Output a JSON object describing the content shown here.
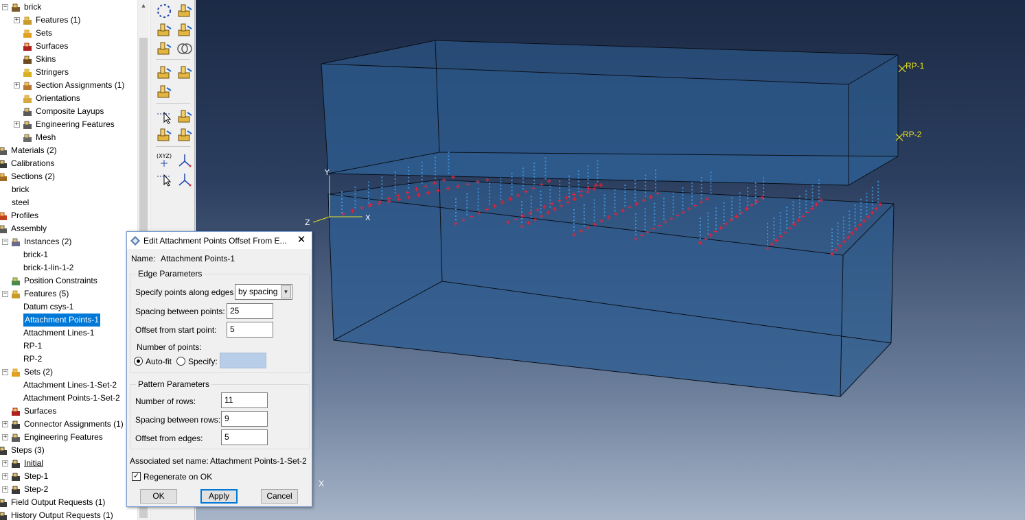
{
  "tree": {
    "items": [
      {
        "label": "brick",
        "indent": 0,
        "exp": "minus",
        "icon": "part"
      },
      {
        "label": "Features (1)",
        "indent": 1,
        "exp": "plus",
        "icon": "features"
      },
      {
        "label": "Sets",
        "indent": 1,
        "exp": "",
        "icon": "sets"
      },
      {
        "label": "Surfaces",
        "indent": 1,
        "exp": "",
        "icon": "surfaces"
      },
      {
        "label": "Skins",
        "indent": 1,
        "exp": "",
        "icon": "skins"
      },
      {
        "label": "Stringers",
        "indent": 1,
        "exp": "",
        "icon": "stringers"
      },
      {
        "label": "Section Assignments (1)",
        "indent": 1,
        "exp": "plus",
        "icon": "section-assign"
      },
      {
        "label": "Orientations",
        "indent": 1,
        "exp": "",
        "icon": "orientations"
      },
      {
        "label": "Composite Layups",
        "indent": 1,
        "exp": "",
        "icon": "layups"
      },
      {
        "label": "Engineering Features",
        "indent": 1,
        "exp": "plus",
        "icon": "eng-features"
      },
      {
        "label": "Mesh",
        "indent": 1,
        "exp": "",
        "icon": "mesh"
      },
      {
        "label": "Materials (2)",
        "indent": -1,
        "exp": "",
        "icon": "materials"
      },
      {
        "label": "Calibrations",
        "indent": -1,
        "exp": "",
        "icon": "calibrations"
      },
      {
        "label": "Sections (2)",
        "indent": -1,
        "exp": "",
        "icon": "sections"
      },
      {
        "label": "brick",
        "indent": 0,
        "exp": "",
        "icon": ""
      },
      {
        "label": "steel",
        "indent": 0,
        "exp": "",
        "icon": ""
      },
      {
        "label": "Profiles",
        "indent": -1,
        "exp": "",
        "icon": "profiles"
      },
      {
        "label": "Assembly",
        "indent": -1,
        "exp": "",
        "icon": "assembly"
      },
      {
        "label": "Instances (2)",
        "indent": 0,
        "exp": "minus",
        "icon": "instances"
      },
      {
        "label": "brick-1",
        "indent": 1,
        "exp": "",
        "icon": ""
      },
      {
        "label": "brick-1-lin-1-2",
        "indent": 1,
        "exp": "",
        "icon": ""
      },
      {
        "label": "Position Constraints",
        "indent": 0,
        "exp": "",
        "icon": "position"
      },
      {
        "label": "Features (5)",
        "indent": 0,
        "exp": "minus",
        "icon": "features"
      },
      {
        "label": "Datum csys-1",
        "indent": 1,
        "exp": "",
        "icon": ""
      },
      {
        "label": "Attachment Points-1",
        "indent": 1,
        "exp": "",
        "icon": "",
        "selected": true
      },
      {
        "label": "Attachment Lines-1",
        "indent": 1,
        "exp": "",
        "icon": ""
      },
      {
        "label": "RP-1",
        "indent": 1,
        "exp": "",
        "icon": ""
      },
      {
        "label": "RP-2",
        "indent": 1,
        "exp": "",
        "icon": ""
      },
      {
        "label": "Sets (2)",
        "indent": 0,
        "exp": "minus",
        "icon": "sets"
      },
      {
        "label": "Attachment Lines-1-Set-2",
        "indent": 1,
        "exp": "",
        "icon": ""
      },
      {
        "label": "Attachment Points-1-Set-2",
        "indent": 1,
        "exp": "",
        "icon": ""
      },
      {
        "label": "Surfaces",
        "indent": 0,
        "exp": "",
        "icon": "surfaces"
      },
      {
        "label": "Connector Assignments (1)",
        "indent": 0,
        "exp": "plus",
        "icon": "connector"
      },
      {
        "label": "Engineering Features",
        "indent": 0,
        "exp": "plus",
        "icon": "eng-features"
      },
      {
        "label": "Steps (3)",
        "indent": -1,
        "exp": "",
        "icon": "steps"
      },
      {
        "label": "Initial",
        "indent": 0,
        "exp": "plus",
        "icon": "step-initial",
        "underline": true
      },
      {
        "label": "Step-1",
        "indent": 0,
        "exp": "plus",
        "icon": "step"
      },
      {
        "label": "Step-2",
        "indent": 0,
        "exp": "plus",
        "icon": "step"
      },
      {
        "label": "Field Output Requests (1)",
        "indent": -1,
        "exp": "",
        "icon": "field-output"
      },
      {
        "label": "History Output Requests (1)",
        "indent": -1,
        "exp": "",
        "icon": "history-output"
      }
    ]
  },
  "toolbox": {
    "tools": [
      "partition-cell-icon",
      "datum-point-icon",
      "datum-axis-icon",
      "datum-plane-icon",
      "attachment-points-icon",
      "boolean-merge-icon",
      "create-feature-icon",
      "feature-move-icon",
      "edit-feature-icon",
      "query-tool-icon",
      "reference-point-icon",
      "attachment-lines-icon",
      "set-tool-icon",
      "csys-icon",
      "datum-csys-icon",
      "translate-icon",
      "rotate-icon"
    ]
  },
  "viewport": {
    "labels": {
      "rp1": "RP-1",
      "rp2": "RP-2",
      "axis_y": "Y",
      "axis_x": "X",
      "axis_z": "Z",
      "axis_corner_x": "X"
    },
    "colors": {
      "box_fill": "#2e5e92",
      "edge": "#0a0f18",
      "marker": "#e0233a",
      "point": "#3f9be6",
      "rp": "#e8e21d"
    }
  },
  "dialog": {
    "title": "Edit Attachment Points Offset From E...",
    "close_label": "✕",
    "name_label": "Name:",
    "name_value": "Attachment Points-1",
    "edge_group": "Edge Parameters",
    "specify_label": "Specify points along edges",
    "specify_value": "by spacing",
    "spacing_label": "Spacing between points:",
    "spacing_value": "25",
    "offset_start_label": "Offset from start point:",
    "offset_start_value": "5",
    "num_points_label": "Number of points:",
    "autofit_label": "Auto-fit",
    "specify_radio_label": "Specify:",
    "specify_radio_value": "",
    "pattern_group": "Pattern Parameters",
    "rows_label": "Number of rows:",
    "rows_value": "11",
    "row_spacing_label": "Spacing between rows:",
    "row_spacing_value": "9",
    "offset_edges_label": "Offset from edges:",
    "offset_edges_value": "5",
    "assoc_label": "Associated set name:",
    "assoc_value": "Attachment Points-1-Set-2",
    "regen_label": "Regenerate on OK",
    "ok_label": "OK",
    "apply_label": "Apply",
    "cancel_label": "Cancel"
  }
}
